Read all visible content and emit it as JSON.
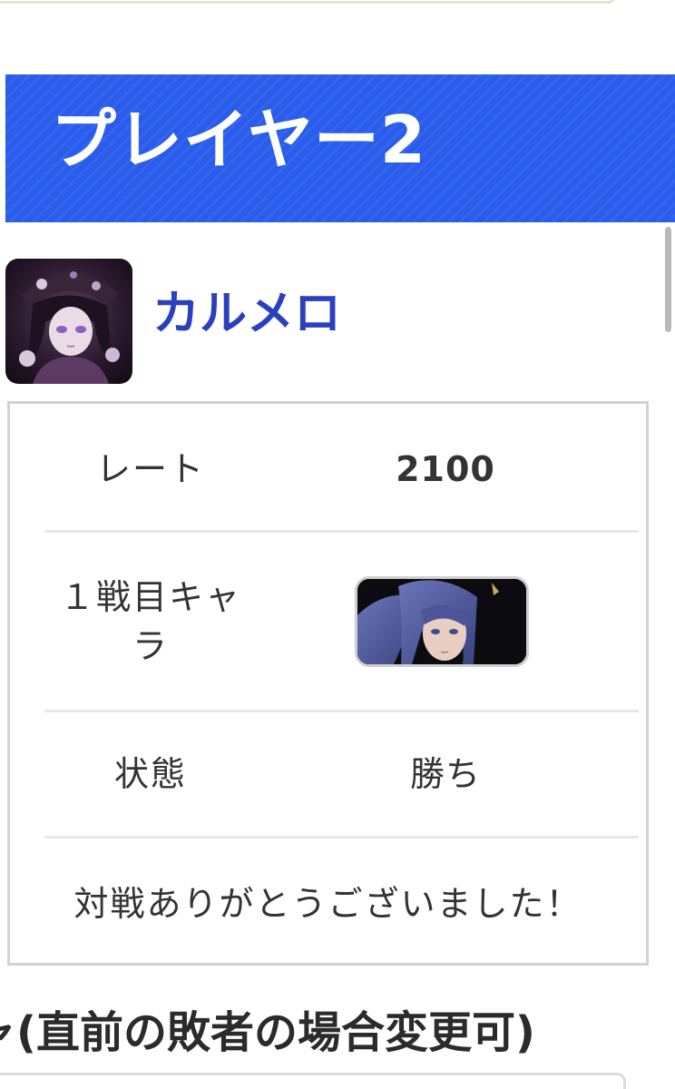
{
  "header": {
    "title": "プレイヤー2",
    "color": "#2a5cec"
  },
  "player": {
    "name": "カルメロ",
    "name_color": "#2b3fbf",
    "avatar": "player-avatar-image"
  },
  "table": {
    "rate_label": "レート",
    "rate_value": "2100",
    "character_label": "１戦目キャラ",
    "character": "fighter-portrait-image",
    "status_label": "状態",
    "status_value": "勝ち",
    "message": "対戦ありがとうございました！"
  },
  "next_section": {
    "heading": "ャ(直前の敗者の場合変更可)"
  }
}
